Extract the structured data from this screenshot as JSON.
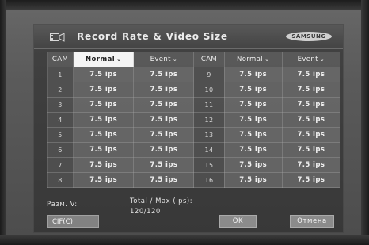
{
  "dialog": {
    "title": "Record Rate & Video Size",
    "brand": "SAMSUNG"
  },
  "table": {
    "headers_left": {
      "cam": "CAM",
      "normal": "Normal",
      "event": "Event"
    },
    "headers_right": {
      "cam": "CAM",
      "normal": "Normal",
      "event": "Event"
    },
    "left_rows": [
      {
        "cam": "1",
        "normal": "7.5 ips",
        "event": "7.5 ips"
      },
      {
        "cam": "2",
        "normal": "7.5 ips",
        "event": "7.5 ips"
      },
      {
        "cam": "3",
        "normal": "7.5 ips",
        "event": "7.5 ips"
      },
      {
        "cam": "4",
        "normal": "7.5 ips",
        "event": "7.5 ips"
      },
      {
        "cam": "5",
        "normal": "7.5 ips",
        "event": "7.5 ips"
      },
      {
        "cam": "6",
        "normal": "7.5 ips",
        "event": "7.5 ips"
      },
      {
        "cam": "7",
        "normal": "7.5 ips",
        "event": "7.5 ips"
      },
      {
        "cam": "8",
        "normal": "7.5 ips",
        "event": "7.5 ips"
      }
    ],
    "right_rows": [
      {
        "cam": "9",
        "normal": "7.5 ips",
        "event": "7.5 ips"
      },
      {
        "cam": "10",
        "normal": "7.5 ips",
        "event": "7.5 ips"
      },
      {
        "cam": "11",
        "normal": "7.5 ips",
        "event": "7.5 ips"
      },
      {
        "cam": "12",
        "normal": "7.5 ips",
        "event": "7.5 ips"
      },
      {
        "cam": "13",
        "normal": "7.5 ips",
        "event": "7.5 ips"
      },
      {
        "cam": "14",
        "normal": "7.5 ips",
        "event": "7.5 ips"
      },
      {
        "cam": "15",
        "normal": "7.5 ips",
        "event": "7.5 ips"
      },
      {
        "cam": "16",
        "normal": "7.5 ips",
        "event": "7.5 ips"
      }
    ]
  },
  "footer": {
    "size_label": "Разм. V:",
    "size_value": "CIF(C)",
    "total_label": "Total / Max (ips):",
    "total_value": "120/120",
    "ok_label": "OK",
    "cancel_label": "Отмена"
  },
  "icons": {
    "title_icon": "camera-film-icon",
    "dropdown": "chevron-down-icon"
  }
}
